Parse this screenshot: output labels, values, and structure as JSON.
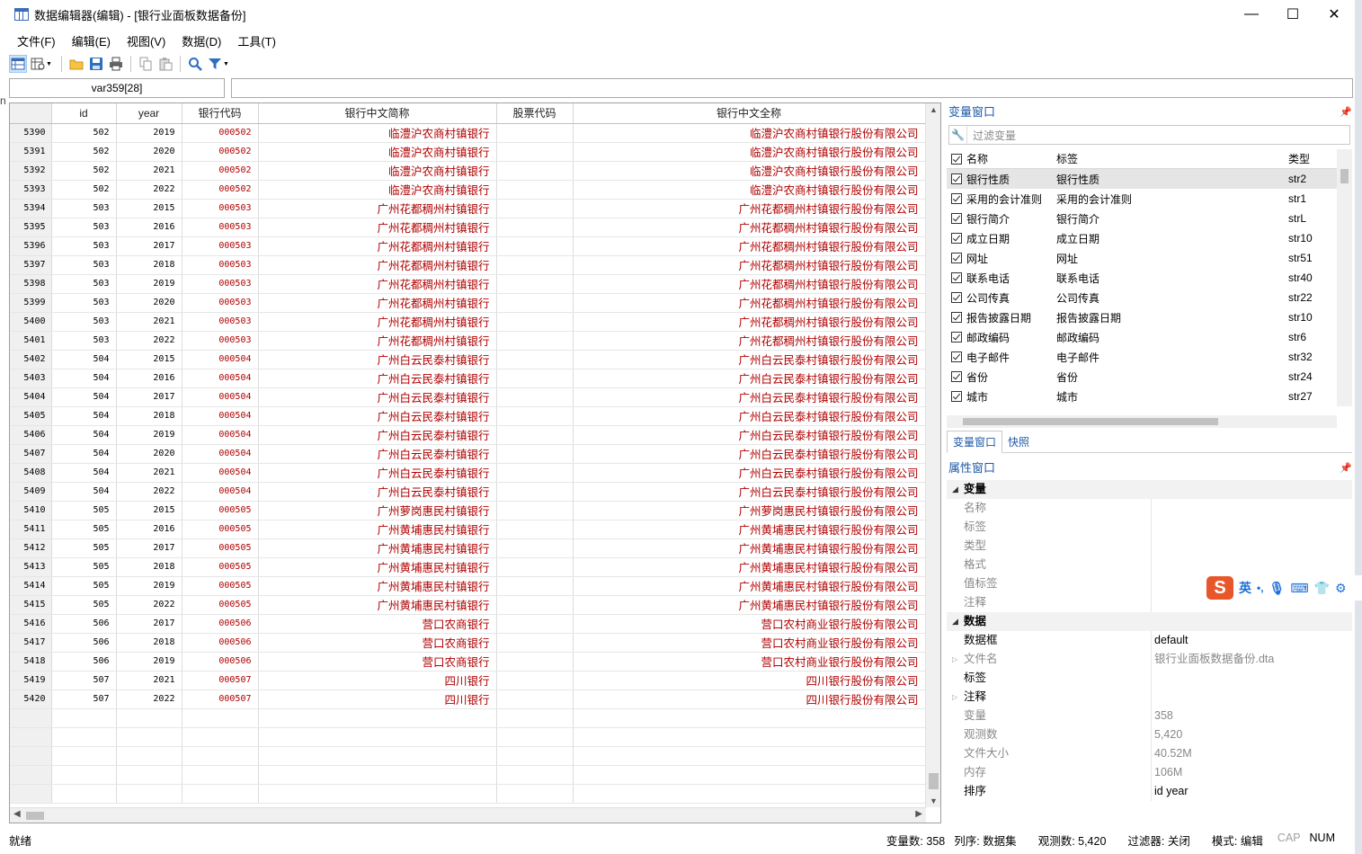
{
  "window": {
    "title": "数据编辑器(编辑) - [银行业面板数据备份]",
    "minimize": "—",
    "maximize": "☐",
    "close": "✕"
  },
  "menu": [
    "文件(F)",
    "编辑(E)",
    "视图(V)",
    "数据(D)",
    "工具(T)"
  ],
  "toolbar_icons": [
    "data-editor-icon",
    "browse-icon",
    "open-folder-icon",
    "save-icon",
    "print-icon",
    "copy-icon",
    "paste-icon",
    "find-icon",
    "filter-icon"
  ],
  "cell_ref": "var359[28]",
  "cell_value": "",
  "grid": {
    "columns": [
      "",
      "id",
      "year",
      "银行代码",
      "银行中文简称",
      "股票代码",
      "银行中文全称"
    ],
    "rows": [
      [
        "5390",
        "502",
        "2019",
        "000502",
        "临澧沪农商村镇银行",
        "",
        "临澧沪农商村镇银行股份有限公司"
      ],
      [
        "5391",
        "502",
        "2020",
        "000502",
        "临澧沪农商村镇银行",
        "",
        "临澧沪农商村镇银行股份有限公司"
      ],
      [
        "5392",
        "502",
        "2021",
        "000502",
        "临澧沪农商村镇银行",
        "",
        "临澧沪农商村镇银行股份有限公司"
      ],
      [
        "5393",
        "502",
        "2022",
        "000502",
        "临澧沪农商村镇银行",
        "",
        "临澧沪农商村镇银行股份有限公司"
      ],
      [
        "5394",
        "503",
        "2015",
        "000503",
        "广州花都稠州村镇银行",
        "",
        "广州花都稠州村镇银行股份有限公司"
      ],
      [
        "5395",
        "503",
        "2016",
        "000503",
        "广州花都稠州村镇银行",
        "",
        "广州花都稠州村镇银行股份有限公司"
      ],
      [
        "5396",
        "503",
        "2017",
        "000503",
        "广州花都稠州村镇银行",
        "",
        "广州花都稠州村镇银行股份有限公司"
      ],
      [
        "5397",
        "503",
        "2018",
        "000503",
        "广州花都稠州村镇银行",
        "",
        "广州花都稠州村镇银行股份有限公司"
      ],
      [
        "5398",
        "503",
        "2019",
        "000503",
        "广州花都稠州村镇银行",
        "",
        "广州花都稠州村镇银行股份有限公司"
      ],
      [
        "5399",
        "503",
        "2020",
        "000503",
        "广州花都稠州村镇银行",
        "",
        "广州花都稠州村镇银行股份有限公司"
      ],
      [
        "5400",
        "503",
        "2021",
        "000503",
        "广州花都稠州村镇银行",
        "",
        "广州花都稠州村镇银行股份有限公司"
      ],
      [
        "5401",
        "503",
        "2022",
        "000503",
        "广州花都稠州村镇银行",
        "",
        "广州花都稠州村镇银行股份有限公司"
      ],
      [
        "5402",
        "504",
        "2015",
        "000504",
        "广州白云民泰村镇银行",
        "",
        "广州白云民泰村镇银行股份有限公司"
      ],
      [
        "5403",
        "504",
        "2016",
        "000504",
        "广州白云民泰村镇银行",
        "",
        "广州白云民泰村镇银行股份有限公司"
      ],
      [
        "5404",
        "504",
        "2017",
        "000504",
        "广州白云民泰村镇银行",
        "",
        "广州白云民泰村镇银行股份有限公司"
      ],
      [
        "5405",
        "504",
        "2018",
        "000504",
        "广州白云民泰村镇银行",
        "",
        "广州白云民泰村镇银行股份有限公司"
      ],
      [
        "5406",
        "504",
        "2019",
        "000504",
        "广州白云民泰村镇银行",
        "",
        "广州白云民泰村镇银行股份有限公司"
      ],
      [
        "5407",
        "504",
        "2020",
        "000504",
        "广州白云民泰村镇银行",
        "",
        "广州白云民泰村镇银行股份有限公司"
      ],
      [
        "5408",
        "504",
        "2021",
        "000504",
        "广州白云民泰村镇银行",
        "",
        "广州白云民泰村镇银行股份有限公司"
      ],
      [
        "5409",
        "504",
        "2022",
        "000504",
        "广州白云民泰村镇银行",
        "",
        "广州白云民泰村镇银行股份有限公司"
      ],
      [
        "5410",
        "505",
        "2015",
        "000505",
        "广州萝岗惠民村镇银行",
        "",
        "广州萝岗惠民村镇银行股份有限公司"
      ],
      [
        "5411",
        "505",
        "2016",
        "000505",
        "广州黄埔惠民村镇银行",
        "",
        "广州黄埔惠民村镇银行股份有限公司"
      ],
      [
        "5412",
        "505",
        "2017",
        "000505",
        "广州黄埔惠民村镇银行",
        "",
        "广州黄埔惠民村镇银行股份有限公司"
      ],
      [
        "5413",
        "505",
        "2018",
        "000505",
        "广州黄埔惠民村镇银行",
        "",
        "广州黄埔惠民村镇银行股份有限公司"
      ],
      [
        "5414",
        "505",
        "2019",
        "000505",
        "广州黄埔惠民村镇银行",
        "",
        "广州黄埔惠民村镇银行股份有限公司"
      ],
      [
        "5415",
        "505",
        "2022",
        "000505",
        "广州黄埔惠民村镇银行",
        "",
        "广州黄埔惠民村镇银行股份有限公司"
      ],
      [
        "5416",
        "506",
        "2017",
        "000506",
        "营口农商银行",
        "",
        "营口农村商业银行股份有限公司"
      ],
      [
        "5417",
        "506",
        "2018",
        "000506",
        "营口农商银行",
        "",
        "营口农村商业银行股份有限公司"
      ],
      [
        "5418",
        "506",
        "2019",
        "000506",
        "营口农商银行",
        "",
        "营口农村商业银行股份有限公司"
      ],
      [
        "5419",
        "507",
        "2021",
        "000507",
        "四川银行",
        "",
        "四川银行股份有限公司"
      ],
      [
        "5420",
        "507",
        "2022",
        "000507",
        "四川银行",
        "",
        "四川银行股份有限公司"
      ]
    ],
    "empty_rows": 5
  },
  "var_window": {
    "title": "变量窗口",
    "filter_placeholder": "过滤变量",
    "headers": {
      "name": "名称",
      "label": "标签",
      "type": "类型"
    },
    "rows": [
      {
        "name": "银行性质",
        "label": "银行性质",
        "type": "str2"
      },
      {
        "name": "采用的会计准则",
        "label": "采用的会计准则",
        "type": "str1"
      },
      {
        "name": "银行简介",
        "label": "银行简介",
        "type": "strL"
      },
      {
        "name": "成立日期",
        "label": "成立日期",
        "type": "str10"
      },
      {
        "name": "网址",
        "label": "网址",
        "type": "str51"
      },
      {
        "name": "联系电话",
        "label": "联系电话",
        "type": "str40"
      },
      {
        "name": "公司传真",
        "label": "公司传真",
        "type": "str22"
      },
      {
        "name": "报告披露日期",
        "label": "报告披露日期",
        "type": "str10"
      },
      {
        "name": "邮政编码",
        "label": "邮政编码",
        "type": "str6"
      },
      {
        "name": "电子邮件",
        "label": "电子邮件",
        "type": "str32"
      },
      {
        "name": "省份",
        "label": "省份",
        "type": "str24"
      },
      {
        "name": "城市",
        "label": "城市",
        "type": "str27"
      }
    ],
    "tabs": [
      "变量窗口",
      "快照"
    ]
  },
  "prop_window": {
    "title": "属性窗口",
    "section_var": "变量",
    "var_props": [
      "名称",
      "标签",
      "类型",
      "格式",
      "值标签",
      "注释"
    ],
    "section_data": "数据",
    "data_props": [
      {
        "key": "数据框",
        "value": "default"
      },
      {
        "key": "文件名",
        "value": "银行业面板数据备份.dta"
      },
      {
        "key": "标签",
        "value": ""
      },
      {
        "key": "注释",
        "value": ""
      },
      {
        "key": "变量",
        "value": "358"
      },
      {
        "key": "观测数",
        "value": "5,420"
      },
      {
        "key": "文件大小",
        "value": "40.52M"
      },
      {
        "key": "内存",
        "value": "106M"
      },
      {
        "key": "排序",
        "value": "id year"
      }
    ]
  },
  "ime": {
    "logo": "S",
    "lang": "英",
    "punct": "•,"
  },
  "status": {
    "ready": "就绪",
    "vars": "变量数: 358",
    "order": "列序: 数据集",
    "obs": "观测数: 5,420",
    "filter": "过滤器: 关闭",
    "mode": "模式: 编辑",
    "cap": "CAP",
    "num": "NUM"
  }
}
